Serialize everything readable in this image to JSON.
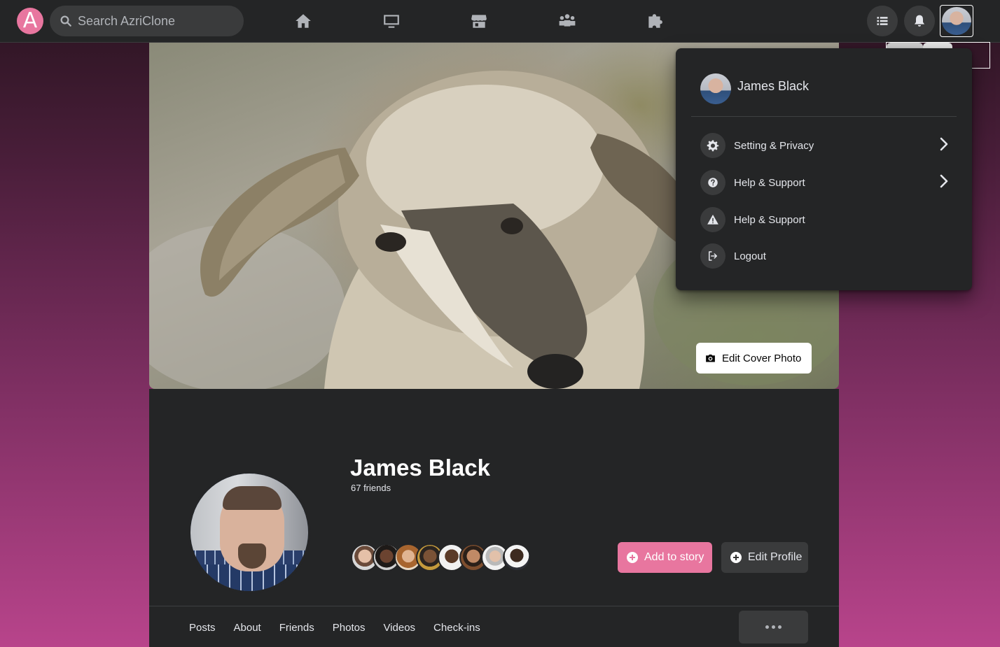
{
  "header": {
    "logo_letter": "A",
    "search_placeholder": "Search AzriClone",
    "nav_icons": [
      "home-icon",
      "watch-icon",
      "marketplace-icon",
      "groups-icon",
      "gaming-icon"
    ],
    "right_icons": [
      "menu-list-icon",
      "bell-icon",
      "avatar"
    ]
  },
  "cover": {
    "edit_cover_label": "Edit Cover Photo"
  },
  "profile": {
    "name": "James Black",
    "friends_count": "67 friends",
    "add_story_label": "Add to story",
    "edit_profile_label": "Edit Profile",
    "friend_avatar_count": 8
  },
  "tabs": [
    "Posts",
    "About",
    "Friends",
    "Photos",
    "Videos",
    "Check-ins"
  ],
  "dropdown": {
    "user_name": "James Black",
    "items": [
      {
        "label": "Setting & Privacy",
        "icon": "gear-icon",
        "chevron": true
      },
      {
        "label": "Help & Support",
        "icon": "question-icon",
        "chevron": true
      },
      {
        "label": "Help & Support",
        "icon": "warning-icon",
        "chevron": false
      },
      {
        "label": "Logout",
        "icon": "logout-icon",
        "chevron": false
      }
    ]
  },
  "colors": {
    "accent": "#e8769f",
    "bar_bg": "#242526",
    "button_bg": "#3a3b3c"
  }
}
